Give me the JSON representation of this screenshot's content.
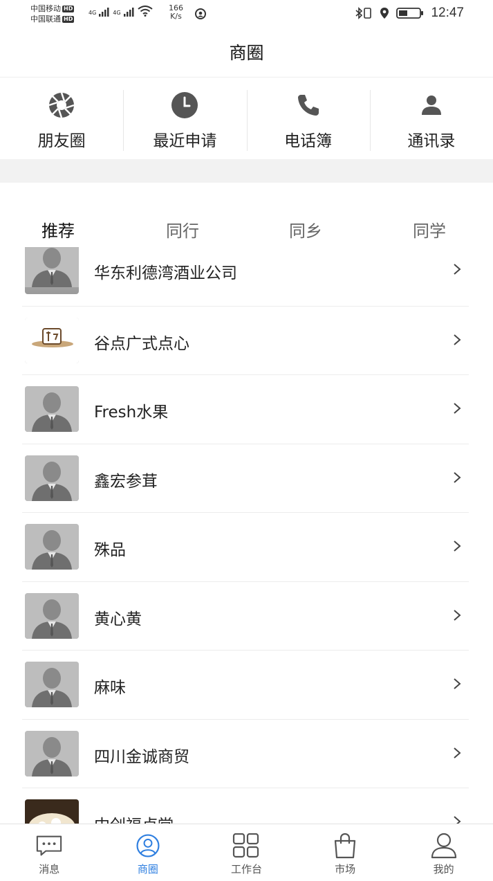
{
  "status_bar": {
    "carrier1": "中国移动",
    "carrier2": "中国联通",
    "hd": "HD",
    "net1": "4G",
    "net2": "4G",
    "speed_value": "166",
    "speed_unit": "K/s",
    "time": "12:47"
  },
  "header": {
    "title": "商圈"
  },
  "quick_actions": [
    {
      "label": "朋友圈",
      "icon": "aperture-icon"
    },
    {
      "label": "最近申请",
      "icon": "clock-icon"
    },
    {
      "label": "电话簿",
      "icon": "phone-icon"
    },
    {
      "label": "通讯录",
      "icon": "person-icon"
    }
  ],
  "tabs": [
    {
      "label": "推荐",
      "active": true
    },
    {
      "label": "同行",
      "active": false
    },
    {
      "label": "同乡",
      "active": false
    },
    {
      "label": "同学",
      "active": false
    }
  ],
  "list": [
    {
      "name": "华东利德湾酒业公司",
      "avatar": "default-avatar"
    },
    {
      "name": "谷点广式点心",
      "avatar": "logo-avatar"
    },
    {
      "name": "Fresh水果",
      "avatar": "default-avatar"
    },
    {
      "name": "鑫宏参茸",
      "avatar": "default-avatar"
    },
    {
      "name": "殊品",
      "avatar": "default-avatar"
    },
    {
      "name": "黄心黄",
      "avatar": "default-avatar"
    },
    {
      "name": "麻味",
      "avatar": "default-avatar"
    },
    {
      "name": "四川金诚商贸",
      "avatar": "default-avatar"
    },
    {
      "name": "中创福卢堂",
      "avatar": "photo-avatar"
    }
  ],
  "bottom_nav": [
    {
      "label": "消息",
      "icon": "chat-icon",
      "active": false
    },
    {
      "label": "商圈",
      "icon": "user-circle-icon",
      "active": true
    },
    {
      "label": "工作台",
      "icon": "grid-icon",
      "active": false
    },
    {
      "label": "市场",
      "icon": "bag-icon",
      "active": false
    },
    {
      "label": "我的",
      "icon": "profile-icon",
      "active": false
    }
  ],
  "colors": {
    "accent": "#2f7fe0",
    "indicator": "#3a8ee6",
    "divider": "#ececec"
  }
}
